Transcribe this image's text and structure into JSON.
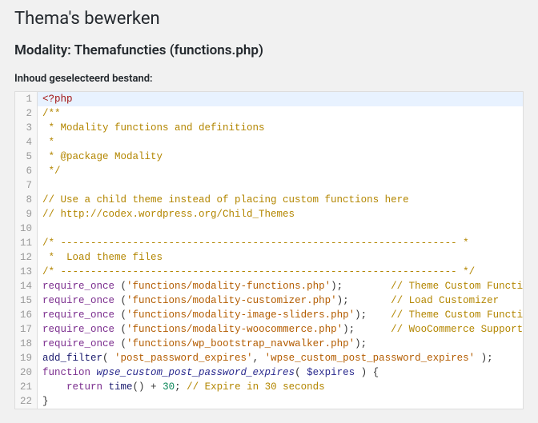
{
  "header": {
    "page_title": "Thema's bewerken",
    "sub_title": "Modality: Themafuncties (functions.php)",
    "content_label": "Inhoud geselecteerd bestand:"
  },
  "editor": {
    "active_line": 1,
    "lines": [
      {
        "n": 1,
        "tokens": [
          {
            "t": "<?php",
            "c": "tok-tag"
          }
        ]
      },
      {
        "n": 2,
        "tokens": [
          {
            "t": "/**",
            "c": "tok-comment"
          }
        ]
      },
      {
        "n": 3,
        "tokens": [
          {
            "t": " * Modality functions and definitions",
            "c": "tok-comment"
          }
        ]
      },
      {
        "n": 4,
        "tokens": [
          {
            "t": " *",
            "c": "tok-comment"
          }
        ]
      },
      {
        "n": 5,
        "tokens": [
          {
            "t": " * @package Modality",
            "c": "tok-comment"
          }
        ]
      },
      {
        "n": 6,
        "tokens": [
          {
            "t": " */",
            "c": "tok-comment"
          }
        ]
      },
      {
        "n": 7,
        "tokens": [
          {
            "t": "",
            "c": "tok-plain"
          }
        ]
      },
      {
        "n": 8,
        "tokens": [
          {
            "t": "// Use a child theme instead of placing custom functions here",
            "c": "tok-comment"
          }
        ]
      },
      {
        "n": 9,
        "tokens": [
          {
            "t": "// http://codex.wordpress.org/Child_Themes",
            "c": "tok-comment"
          }
        ]
      },
      {
        "n": 10,
        "tokens": [
          {
            "t": "",
            "c": "tok-plain"
          }
        ]
      },
      {
        "n": 11,
        "tokens": [
          {
            "t": "/* ------------------------------------------------------------------ *",
            "c": "tok-comment"
          }
        ]
      },
      {
        "n": 12,
        "tokens": [
          {
            "t": " *  Load theme files",
            "c": "tok-comment"
          }
        ]
      },
      {
        "n": 13,
        "tokens": [
          {
            "t": "/* ------------------------------------------------------------------ */",
            "c": "tok-comment"
          }
        ]
      },
      {
        "n": 14,
        "tokens": [
          {
            "t": "require_once ",
            "c": "tok-keyword"
          },
          {
            "t": "(",
            "c": "tok-plain"
          },
          {
            "t": "'functions/modality-functions.php'",
            "c": "tok-string"
          },
          {
            "t": ");        ",
            "c": "tok-plain"
          },
          {
            "t": "// Theme Custom Functions",
            "c": "tok-comment"
          }
        ]
      },
      {
        "n": 15,
        "tokens": [
          {
            "t": "require_once ",
            "c": "tok-keyword"
          },
          {
            "t": "(",
            "c": "tok-plain"
          },
          {
            "t": "'functions/modality-customizer.php'",
            "c": "tok-string"
          },
          {
            "t": ");       ",
            "c": "tok-plain"
          },
          {
            "t": "// Load Customizer",
            "c": "tok-comment"
          }
        ]
      },
      {
        "n": 16,
        "tokens": [
          {
            "t": "require_once ",
            "c": "tok-keyword"
          },
          {
            "t": "(",
            "c": "tok-plain"
          },
          {
            "t": "'functions/modality-image-sliders.php'",
            "c": "tok-string"
          },
          {
            "t": ");    ",
            "c": "tok-plain"
          },
          {
            "t": "// Theme Custom Functions",
            "c": "tok-comment"
          }
        ]
      },
      {
        "n": 17,
        "tokens": [
          {
            "t": "require_once ",
            "c": "tok-keyword"
          },
          {
            "t": "(",
            "c": "tok-plain"
          },
          {
            "t": "'functions/modality-woocommerce.php'",
            "c": "tok-string"
          },
          {
            "t": ");      ",
            "c": "tok-plain"
          },
          {
            "t": "// WooCommerce Support",
            "c": "tok-comment"
          }
        ]
      },
      {
        "n": 18,
        "tokens": [
          {
            "t": "require_once ",
            "c": "tok-keyword"
          },
          {
            "t": "(",
            "c": "tok-plain"
          },
          {
            "t": "'functions/wp_bootstrap_navwalker.php'",
            "c": "tok-string"
          },
          {
            "t": ");",
            "c": "tok-plain"
          }
        ]
      },
      {
        "n": 19,
        "tokens": [
          {
            "t": "add_filter",
            "c": "tok-name"
          },
          {
            "t": "( ",
            "c": "tok-plain"
          },
          {
            "t": "'post_password_expires'",
            "c": "tok-string"
          },
          {
            "t": ", ",
            "c": "tok-plain"
          },
          {
            "t": "'wpse_custom_post_password_expires'",
            "c": "tok-string"
          },
          {
            "t": " );",
            "c": "tok-plain"
          }
        ]
      },
      {
        "n": 20,
        "tokens": [
          {
            "t": "function ",
            "c": "tok-keyword"
          },
          {
            "t": "wpse_custom_post_password_expires",
            "c": "tok-func"
          },
          {
            "t": "( ",
            "c": "tok-plain"
          },
          {
            "t": "$expires",
            "c": "tok-var"
          },
          {
            "t": " ) {",
            "c": "tok-plain"
          }
        ]
      },
      {
        "n": 21,
        "tokens": [
          {
            "t": "    ",
            "c": "tok-plain"
          },
          {
            "t": "return ",
            "c": "tok-keyword"
          },
          {
            "t": "time",
            "c": "tok-name"
          },
          {
            "t": "() + ",
            "c": "tok-plain"
          },
          {
            "t": "30",
            "c": "tok-num"
          },
          {
            "t": "; ",
            "c": "tok-plain"
          },
          {
            "t": "// Expire in 30 seconds",
            "c": "tok-comment"
          }
        ]
      },
      {
        "n": 22,
        "tokens": [
          {
            "t": "}",
            "c": "tok-plain"
          }
        ]
      }
    ]
  }
}
